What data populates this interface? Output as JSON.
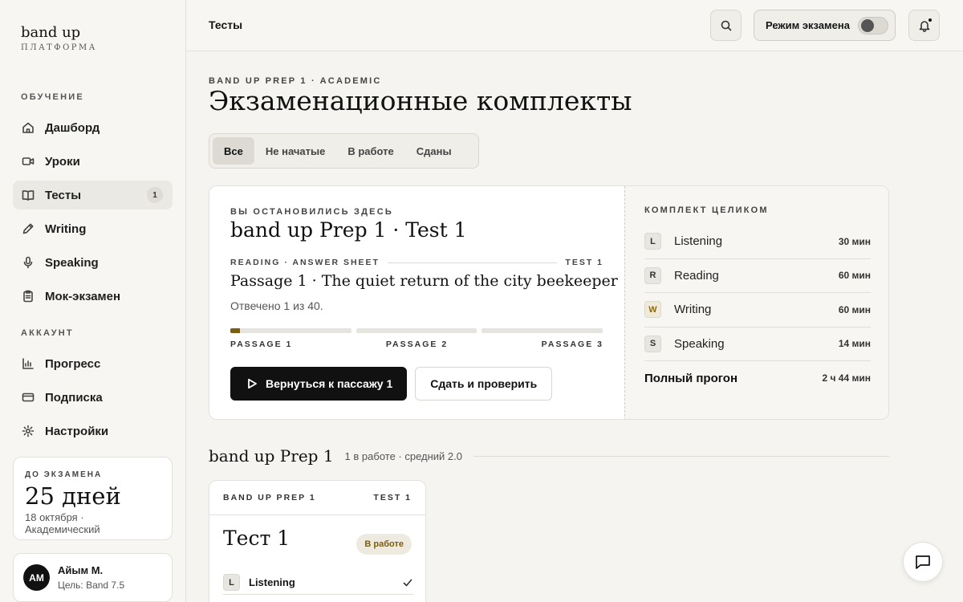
{
  "brand": {
    "name": "band up",
    "subtitle": "ПЛАТФОРМА"
  },
  "sidebar": {
    "section_learning": "ОБУЧЕНИЕ",
    "section_account": "АККАУНТ",
    "learning_items": [
      {
        "label": "Дашборд",
        "icon": "home-icon"
      },
      {
        "label": "Уроки",
        "icon": "video-icon"
      },
      {
        "label": "Тесты",
        "icon": "book-icon",
        "badge": "1",
        "active": true
      },
      {
        "label": "Writing",
        "icon": "pen-icon"
      },
      {
        "label": "Speaking",
        "icon": "mic-icon"
      },
      {
        "label": "Мок-экзамен",
        "icon": "clipboard-icon"
      }
    ],
    "account_items": [
      {
        "label": "Прогресс",
        "icon": "chart-icon"
      },
      {
        "label": "Подписка",
        "icon": "card-icon"
      },
      {
        "label": "Настройки",
        "icon": "gear-icon"
      }
    ],
    "exam": {
      "label": "ДО ЭКЗАМЕНА",
      "days": "25 дней",
      "date": "18 октября · Академический"
    },
    "user": {
      "initials": "АМ",
      "name": "Айым М.",
      "goal": "Цель: Band 7.5"
    }
  },
  "topbar": {
    "title": "Тесты",
    "exam_mode_label": "Режим экзамена",
    "exam_mode_on": false
  },
  "main": {
    "eyebrow": "BAND UP PREP 1 · ACADEMIC",
    "title": "Экзаменационные комплекты",
    "filters": [
      "Все",
      "Не начатые",
      "В работе",
      "Сданы"
    ],
    "active_filter": "Все"
  },
  "resume": {
    "eyebrow": "ВЫ ОСТАНОВИЛИСЬ ЗДЕСЬ",
    "title": "band up Prep 1 · Test 1",
    "sheet_label": "READING · ANSWER SHEET",
    "sheet_test": "TEST 1",
    "passage_title": "Passage 1 · The quiet return of the city beekeeper",
    "answered": "Отвечено 1 из 40.",
    "passages": [
      {
        "label": "PASSAGE 1",
        "progress": 0.08
      },
      {
        "label": "PASSAGE 2",
        "progress": 0
      },
      {
        "label": "PASSAGE 3",
        "progress": 0
      }
    ],
    "primary_button": "Вернуться к пассажу 1",
    "secondary_button": "Сдать и проверить",
    "accent_color": "#7a5d12"
  },
  "full_set": {
    "label": "КОМПЛЕКТ ЦЕЛИКОМ",
    "rows": [
      {
        "letter": "L",
        "name": "Listening",
        "duration": "30 мин"
      },
      {
        "letter": "R",
        "name": "Reading",
        "duration": "60 мин"
      },
      {
        "letter": "W",
        "name": "Writing",
        "duration": "60 мин"
      },
      {
        "letter": "S",
        "name": "Speaking",
        "duration": "14 мин"
      }
    ],
    "total_label": "Полный прогон",
    "total_duration": "2 ч 44 мин"
  },
  "group": {
    "title": "band up Prep 1",
    "meta": "1 в работе · средний 2.0"
  },
  "test_card": {
    "set": "BAND UP PREP 1",
    "test": "TEST 1",
    "title": "Тест 1",
    "status": "В работе",
    "rows": [
      {
        "letter": "L",
        "name": "Listening",
        "done": true
      }
    ]
  }
}
